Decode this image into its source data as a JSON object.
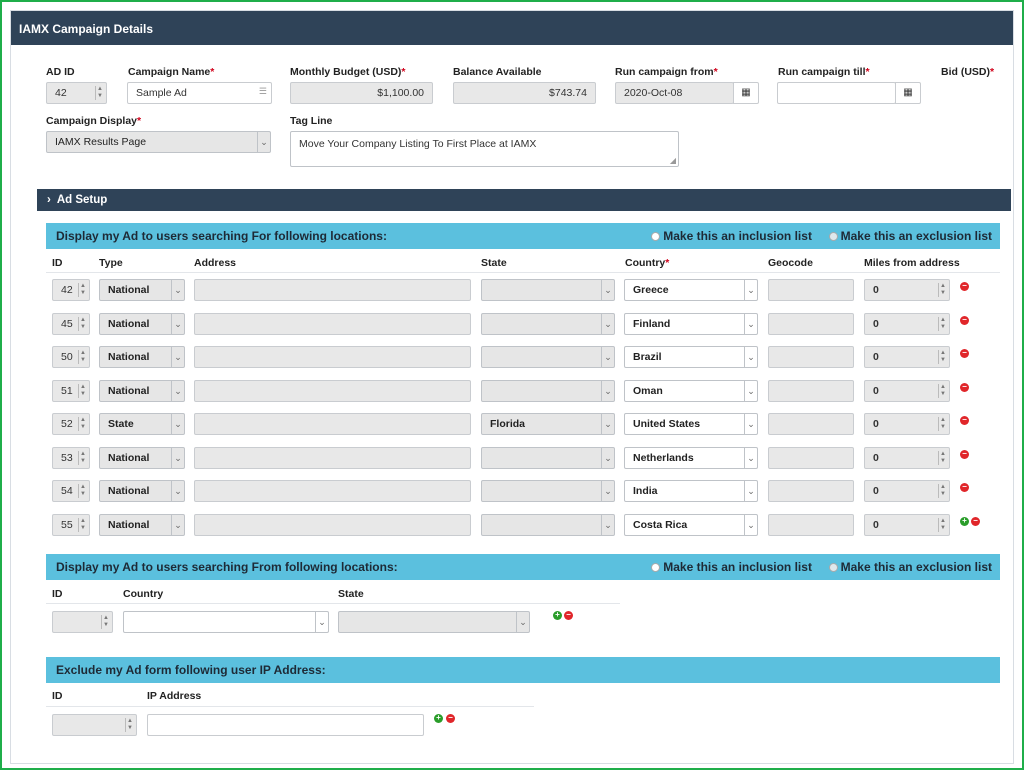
{
  "header": {
    "title": "IAMX Campaign Details"
  },
  "campaign": {
    "ad_id_label": "AD ID",
    "ad_id": "42",
    "name_label": "Campaign Name",
    "name": "Sample Ad",
    "budget_label": "Monthly Budget (USD)",
    "budget": "$1,100.00",
    "balance_label": "Balance Available",
    "balance": "$743.74",
    "run_from_label": "Run campaign from",
    "run_from": "2020-Oct-08",
    "run_till_label": "Run campaign till",
    "run_till": "",
    "bid_label": "Bid (USD)",
    "display_label": "Campaign Display",
    "display": "IAMX Results Page",
    "tagline_label": "Tag Line",
    "tagline": "Move Your Company Listing To First Place at IAMX",
    "required_mark": "*"
  },
  "ad_setup": {
    "title": "Ad Setup"
  },
  "for_locations": {
    "title": "Display my Ad to users searching For following locations:",
    "inclusion_label": "Make this an inclusion list",
    "exclusion_label": "Make this an exclusion list",
    "columns": {
      "id": "ID",
      "type": "Type",
      "address": "Address",
      "state": "State",
      "country": "Country",
      "geocode": "Geocode",
      "miles": "Miles from address"
    },
    "rows": [
      {
        "id": "42",
        "type": "National",
        "state": "",
        "country": "Greece",
        "miles": "0"
      },
      {
        "id": "45",
        "type": "National",
        "state": "",
        "country": "Finland",
        "miles": "0"
      },
      {
        "id": "50",
        "type": "National",
        "state": "",
        "country": "Brazil",
        "miles": "0"
      },
      {
        "id": "51",
        "type": "National",
        "state": "",
        "country": "Oman",
        "miles": "0"
      },
      {
        "id": "52",
        "type": "State",
        "state": "Florida",
        "country": "United States",
        "miles": "0"
      },
      {
        "id": "53",
        "type": "National",
        "state": "",
        "country": "Netherlands",
        "miles": "0"
      },
      {
        "id": "54",
        "type": "National",
        "state": "",
        "country": "India",
        "miles": "0"
      },
      {
        "id": "55",
        "type": "National",
        "state": "",
        "country": "Costa Rica",
        "miles": "0"
      }
    ]
  },
  "from_locations": {
    "title": "Display my Ad to users searching From following locations:",
    "inclusion_label": "Make this an inclusion list",
    "exclusion_label": "Make this an exclusion list",
    "columns": {
      "id": "ID",
      "country": "Country",
      "state": "State"
    }
  },
  "ip_exclude": {
    "title": "Exclude my Ad form following user IP Address:",
    "columns": {
      "id": "ID",
      "ip": "IP Address"
    }
  },
  "colors": {
    "header": "#2f4358",
    "section": "#5bc0de",
    "frame": "#1fae4a"
  }
}
